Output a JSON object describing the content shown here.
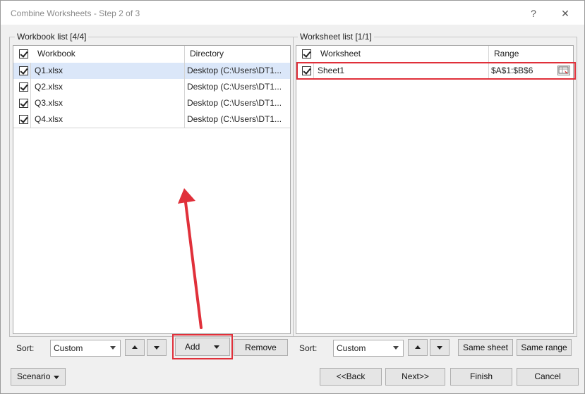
{
  "window": {
    "title": "Combine Worksheets - Step 2 of 3",
    "help_glyph": "?",
    "close_glyph": "✕"
  },
  "workbook_panel": {
    "title": "Workbook list [4/4]",
    "columns": [
      "Workbook",
      "Directory"
    ],
    "rows": [
      {
        "name": "Q1.xlsx",
        "directory": "Desktop (C:\\Users\\DT1...",
        "checked": true,
        "selected": true
      },
      {
        "name": "Q2.xlsx",
        "directory": "Desktop (C:\\Users\\DT1...",
        "checked": true,
        "selected": false
      },
      {
        "name": "Q3.xlsx",
        "directory": "Desktop (C:\\Users\\DT1...",
        "checked": true,
        "selected": false
      },
      {
        "name": "Q4.xlsx",
        "directory": "Desktop (C:\\Users\\DT1...",
        "checked": true,
        "selected": false
      }
    ],
    "sort_label": "Sort:",
    "sort_value": "Custom",
    "add_label": "Add",
    "remove_label": "Remove"
  },
  "worksheet_panel": {
    "title": "Worksheet list [1/1]",
    "columns": [
      "Worksheet",
      "Range"
    ],
    "rows": [
      {
        "name": "Sheet1",
        "range": "$A$1:$B$6",
        "checked": true
      }
    ],
    "sort_label": "Sort:",
    "sort_value": "Custom",
    "same_sheet_label": "Same sheet",
    "same_range_label": "Same range"
  },
  "footer": {
    "scenario_label": "Scenario",
    "back_label": "<<Back",
    "next_label": "Next>>",
    "finish_label": "Finish",
    "cancel_label": "Cancel"
  },
  "colors": {
    "highlight": "#e0303a",
    "selected_row": "#dbe7f9"
  }
}
